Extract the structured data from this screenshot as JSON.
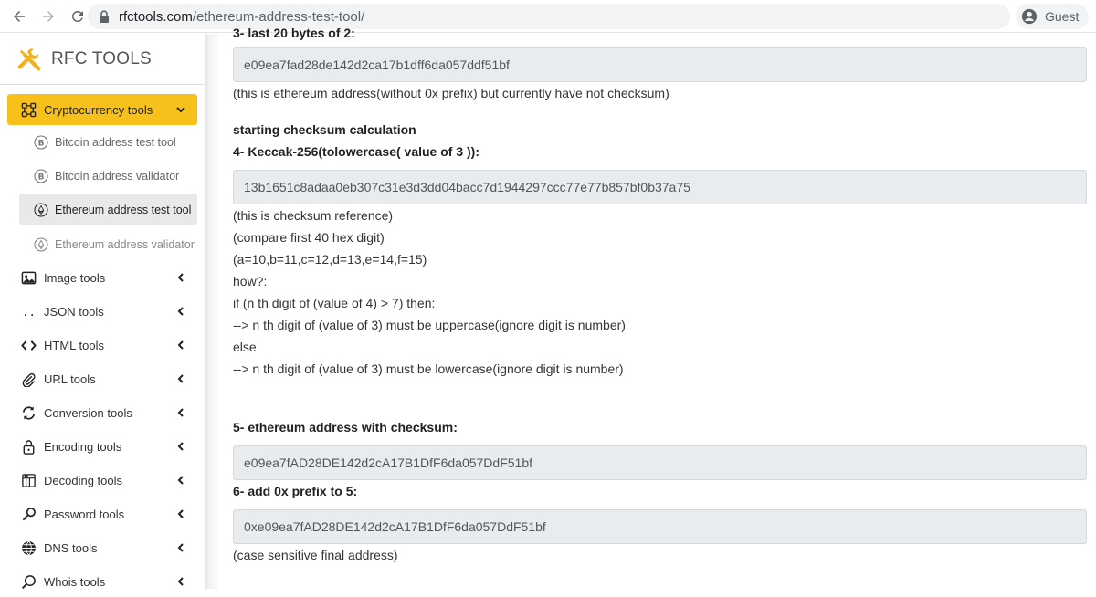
{
  "browser": {
    "url_host": "rfctools.com",
    "url_path": "/ethereum-address-test-tool/",
    "profile_label": "Guest"
  },
  "sidebar": {
    "brand": "RFC TOOLS",
    "active_section": "Cryptocurrency tools",
    "sub_items": [
      "Bitcoin address test tool",
      "Bitcoin address validator",
      "Ethereum address test tool",
      "Ethereum address validator"
    ],
    "sections": [
      "Image tools",
      "JSON tools",
      "HTML tools",
      "URL tools",
      "Conversion tools",
      "Encoding tools",
      "Decoding tools",
      "Password tools",
      "DNS tools",
      "Whois tools"
    ]
  },
  "content": {
    "clipped_heading": "3- last 20 bytes of 2:",
    "value3": "e09ea7fad28de142d2ca17b1dff6da057ddf51bf",
    "note3": "(this is ethereum address(without 0x prefix) but currently have not checksum)",
    "checksum_title": "starting checksum calculation",
    "step4_title": "4- Keccak-256(tolowercase( value of 3 )):",
    "value4": "13b1651c8adaa0eb307c31e3d3dd04bacc7d1944297ccc77e77b857bf0b37a75",
    "explain": [
      "(this is checksum reference)",
      "(compare first 40 hex digit)",
      "(a=10,b=11,c=12,d=13,e=14,f=15)",
      "how?:",
      "if (n th digit of (value of 4) > 7) then:",
      "--> n th digit of (value of 3) must be uppercase(ignore digit is number)",
      "else",
      "--> n th digit of (value of 3) must be lowercase(ignore digit is number)"
    ],
    "step5_title": "5- ethereum address with checksum:",
    "value5": "e09ea7fAD28DE142d2cA17B1DfF6da057DdF51bf",
    "step6_title": "6- add 0x prefix to 5:",
    "value6": "0xe09ea7fAD28DE142d2cA17B1DfF6da057DdF51bf",
    "note6": "(case sensitive final address)"
  },
  "colors": {
    "active_menu": "#f7c01a",
    "value_box_bg": "#e9ecef",
    "brand_icon": "#f2b21a"
  }
}
